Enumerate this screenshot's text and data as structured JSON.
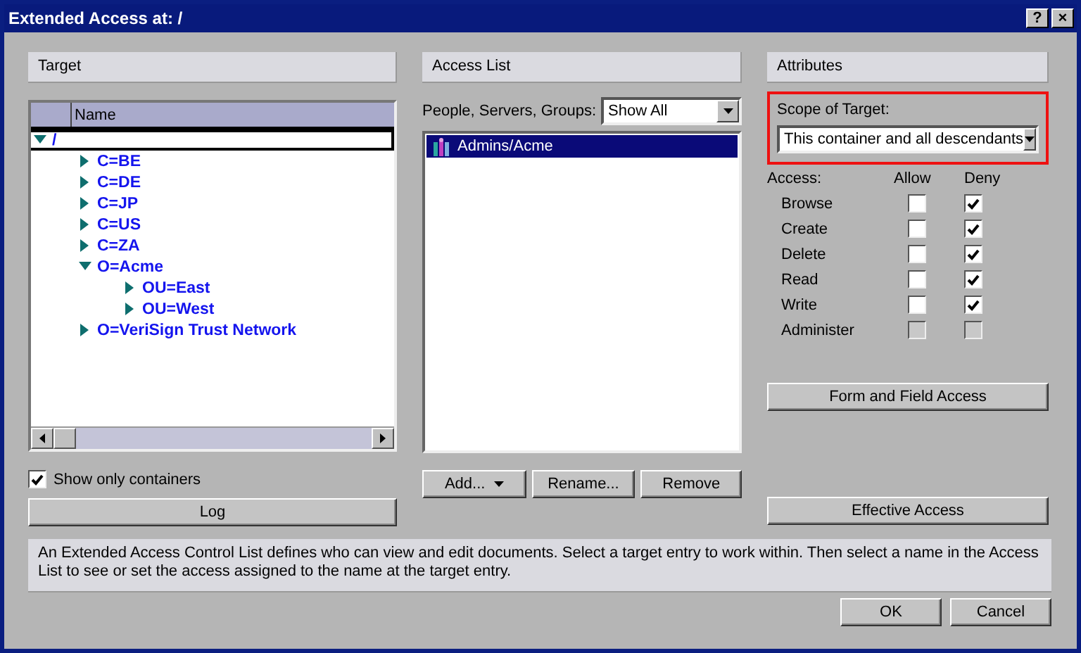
{
  "window": {
    "title": "Extended Access at: /",
    "buttons": [
      "?",
      "×"
    ]
  },
  "target": {
    "heading": "Target",
    "columns": [
      "Name"
    ],
    "tree": [
      {
        "label": "/",
        "expanded": true,
        "selected": true,
        "children": [
          {
            "label": "C=BE",
            "expanded": false,
            "selected": false
          },
          {
            "label": "C=DE",
            "expanded": false,
            "selected": false
          },
          {
            "label": "C=JP",
            "expanded": false,
            "selected": false
          },
          {
            "label": "C=US",
            "expanded": false,
            "selected": false
          },
          {
            "label": "C=ZA",
            "expanded": false,
            "selected": false
          },
          {
            "label": "O=Acme",
            "expanded": true,
            "selected": false,
            "children": [
              {
                "label": "OU=East",
                "expanded": false,
                "selected": false
              },
              {
                "label": "OU=West",
                "expanded": false,
                "selected": false
              }
            ]
          },
          {
            "label": "O=VeriSign Trust Network",
            "expanded": false,
            "selected": false
          }
        ]
      }
    ],
    "show_only_containers": {
      "label": "Show only containers",
      "checked": true
    },
    "log_button": "Log"
  },
  "access_list": {
    "heading": "Access List",
    "filter_label": "People, Servers, Groups:",
    "filter_value": "Show All",
    "entries": [
      {
        "name": "Admins/Acme",
        "selected": true
      }
    ],
    "buttons": [
      {
        "label": "Add...",
        "kind": "menu"
      },
      {
        "label": "Rename...",
        "kind": "plain"
      },
      {
        "label": "Remove",
        "kind": "plain"
      }
    ]
  },
  "attributes": {
    "heading": "Attributes",
    "scope_label": "Scope of Target:",
    "scope_value": "This container and all descendants",
    "access_label": "Access:",
    "columns": [
      "Allow",
      "Deny"
    ],
    "rights": [
      {
        "name": "Browse",
        "allow": {
          "checked": false,
          "disabled": false
        },
        "deny": {
          "checked": true,
          "disabled": false
        }
      },
      {
        "name": "Create",
        "allow": {
          "checked": false,
          "disabled": false
        },
        "deny": {
          "checked": true,
          "disabled": false
        }
      },
      {
        "name": "Delete",
        "allow": {
          "checked": false,
          "disabled": false
        },
        "deny": {
          "checked": true,
          "disabled": false
        }
      },
      {
        "name": "Read",
        "allow": {
          "checked": false,
          "disabled": false
        },
        "deny": {
          "checked": true,
          "disabled": false
        }
      },
      {
        "name": "Write",
        "allow": {
          "checked": false,
          "disabled": false
        },
        "deny": {
          "checked": true,
          "disabled": false
        }
      },
      {
        "name": "Administer",
        "allow": {
          "checked": false,
          "disabled": true
        },
        "deny": {
          "checked": false,
          "disabled": true
        }
      }
    ],
    "form_button": "Form and Field Access",
    "effective_button": "Effective Access"
  },
  "description": "An Extended Access Control List defines who can view and edit documents.  Select a target entry to work within.  Then select a name in the Access List to see or set the access assigned to the name at the target entry.",
  "buttons": [
    "OK",
    "Cancel"
  ]
}
